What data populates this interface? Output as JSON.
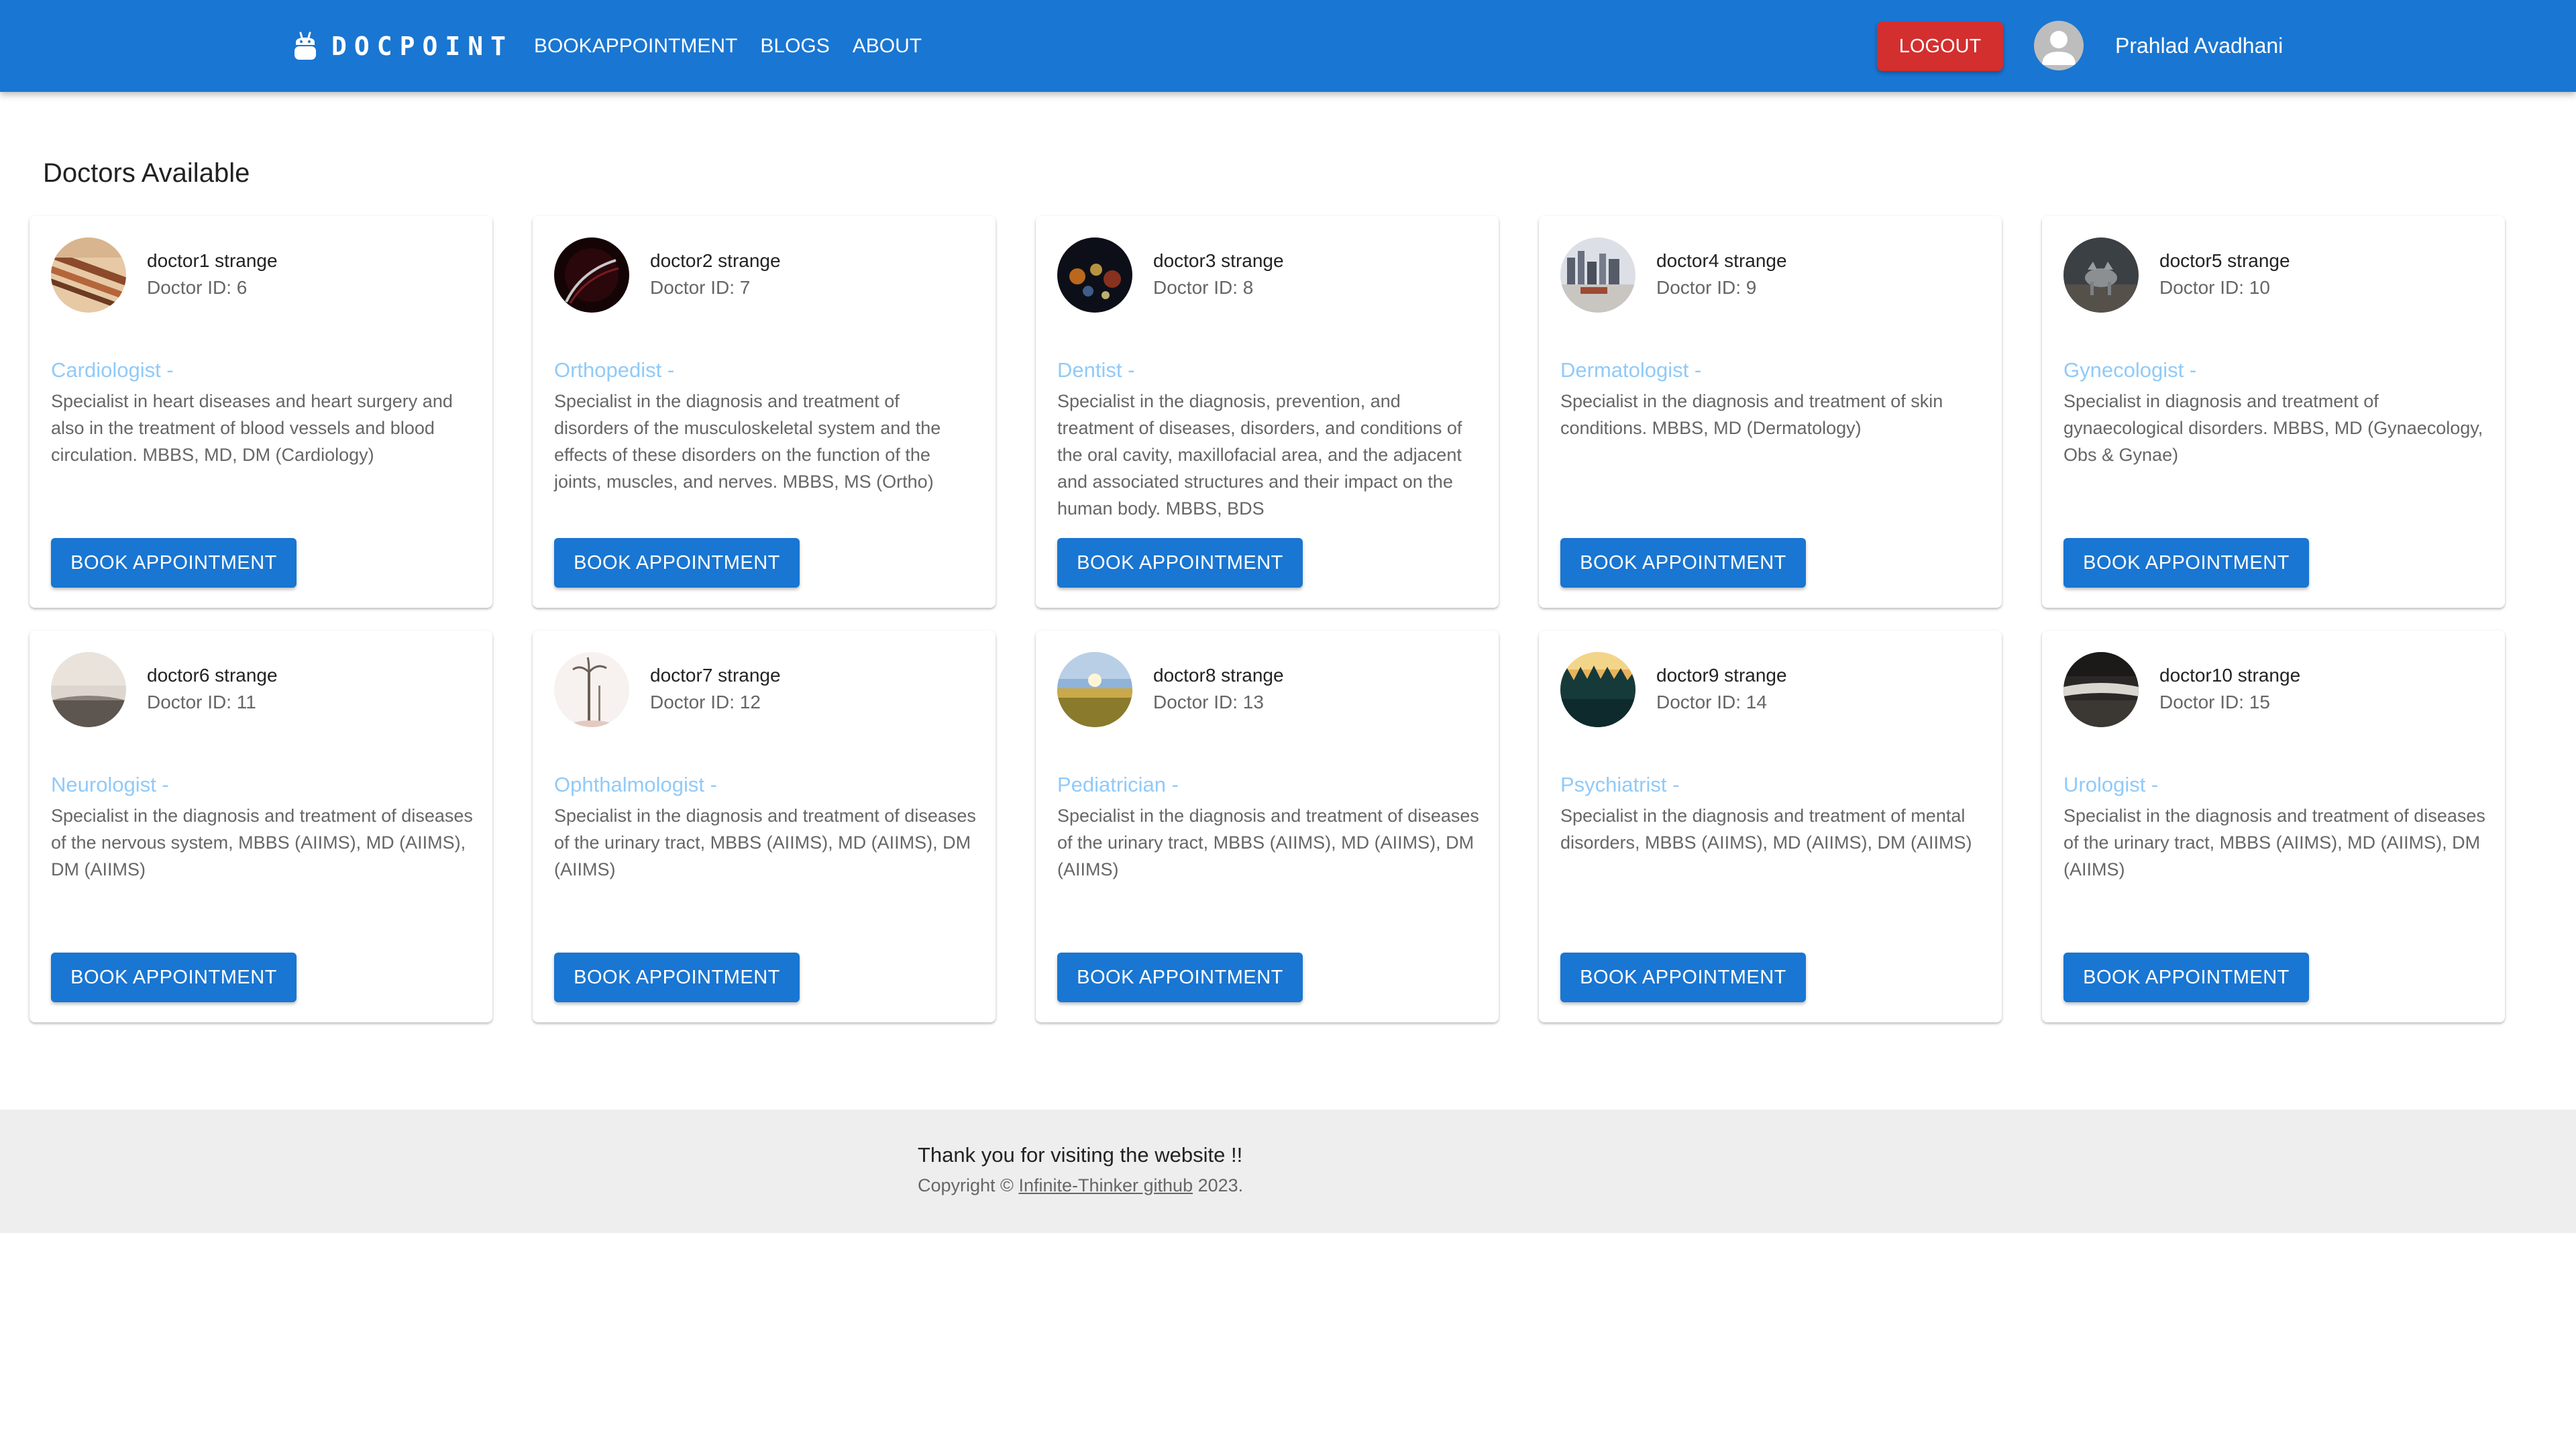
{
  "header": {
    "brand": "DOCPOINT",
    "nav": [
      "BOOKAPPOINTMENT",
      "BLOGS",
      "ABOUT"
    ],
    "logout_label": "LOGOUT",
    "user_name": "Prahlad Avadhani",
    "accent": "#1976d2",
    "logout_color": "#d32f2f"
  },
  "main": {
    "title": "Doctors Available",
    "button_label": "BOOK APPOINTMENT",
    "doctors": [
      {
        "name": "doctor1 strange",
        "id": "Doctor ID: 6",
        "specialty": "Cardiologist -",
        "description": "Specialist in heart diseases and heart surgery and also in the treatment of blood vessels and blood circulation. MBBS, MD, DM (Cardiology)"
      },
      {
        "name": "doctor2 strange",
        "id": "Doctor ID: 7",
        "specialty": "Orthopedist -",
        "description": "Specialist in the diagnosis and treatment of disorders of the musculoskeletal system and the effects of these disorders on the function of the joints, muscles, and nerves. MBBS, MS (Ortho)"
      },
      {
        "name": "doctor3 strange",
        "id": "Doctor ID: 8",
        "specialty": "Dentist -",
        "description": "Specialist in the diagnosis, prevention, and treatment of diseases, disorders, and conditions of the oral cavity, maxillofacial area, and the adjacent and associated structures and their impact on the human body. MBBS, BDS"
      },
      {
        "name": "doctor4 strange",
        "id": "Doctor ID: 9",
        "specialty": "Dermatologist -",
        "description": "Specialist in the diagnosis and treatment of skin conditions. MBBS, MD (Dermatology)"
      },
      {
        "name": "doctor5 strange",
        "id": "Doctor ID: 10",
        "specialty": "Gynecologist -",
        "description": "Specialist in diagnosis and treatment of gynaecological disorders. MBBS, MD (Gynaecology, Obs & Gynae)"
      },
      {
        "name": "doctor6 strange",
        "id": "Doctor ID: 11",
        "specialty": "Neurologist -",
        "description": "Specialist in the diagnosis and treatment of diseases of the nervous system, MBBS (AIIMS), MD (AIIMS), DM (AIIMS)"
      },
      {
        "name": "doctor7 strange",
        "id": "Doctor ID: 12",
        "specialty": "Ophthalmologist -",
        "description": "Specialist in the diagnosis and treatment of diseases of the urinary tract, MBBS (AIIMS), MD (AIIMS), DM (AIIMS)"
      },
      {
        "name": "doctor8 strange",
        "id": "Doctor ID: 13",
        "specialty": "Pediatrician -",
        "description": "Specialist in the diagnosis and treatment of diseases of the urinary tract, MBBS (AIIMS), MD (AIIMS), DM (AIIMS)"
      },
      {
        "name": "doctor9 strange",
        "id": "Doctor ID: 14",
        "specialty": "Psychiatrist -",
        "description": "Specialist in the diagnosis and treatment of mental disorders, MBBS (AIIMS), MD (AIIMS), DM (AIIMS)"
      },
      {
        "name": "doctor10 strange",
        "id": "Doctor ID: 15",
        "specialty": "Urologist -",
        "description": "Specialist in the diagnosis and treatment of diseases of the urinary tract, MBBS (AIIMS), MD (AIIMS), DM (AIIMS)"
      }
    ]
  },
  "footer": {
    "thanks": "Thank you for visiting the website !!",
    "copyright_prefix": "Copyright © ",
    "link_text": "Infinite-Thinker github",
    "copyright_suffix": " 2023."
  }
}
